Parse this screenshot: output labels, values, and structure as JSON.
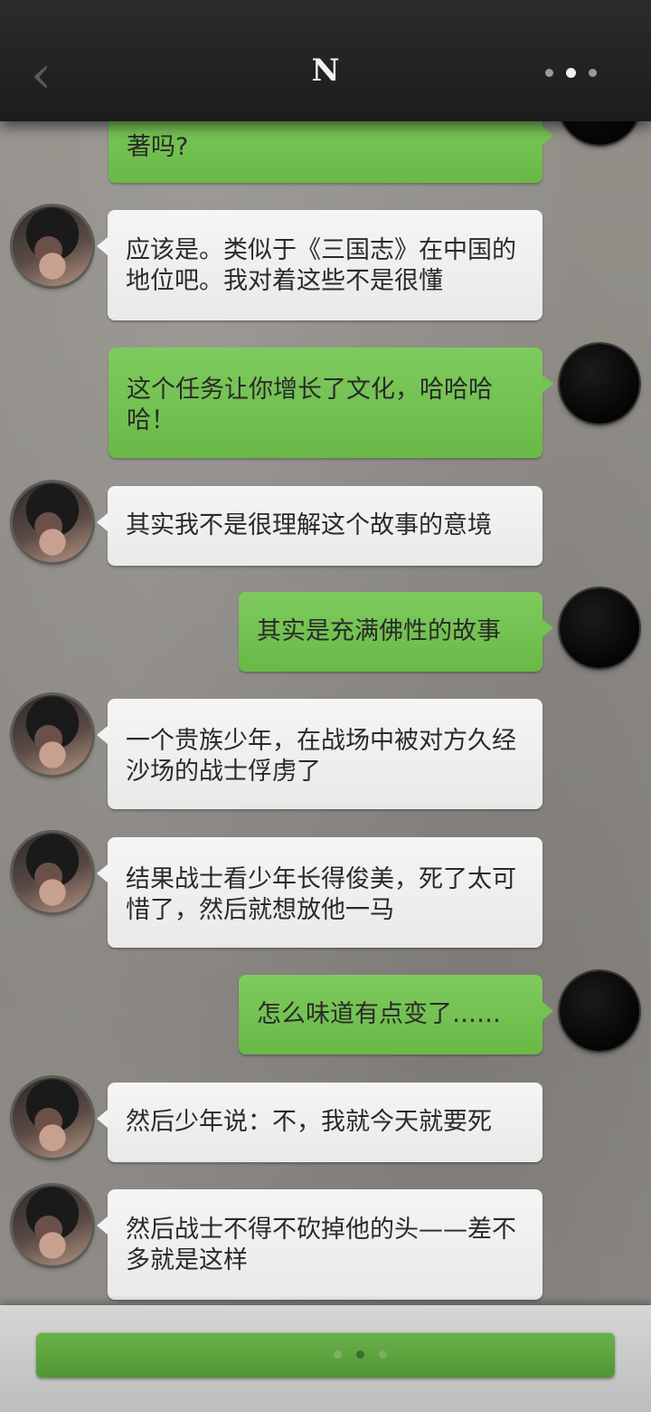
{
  "header": {
    "title": "N",
    "back_glyph": "‹"
  },
  "messages": [
    {
      "side": "right",
      "text": "著吗?"
    },
    {
      "side": "left",
      "text": "应该是。类似于《三国志》在中国的地位吧。我对着这些不是很懂"
    },
    {
      "side": "right",
      "text": "这个任务让你增长了文化，哈哈哈哈！"
    },
    {
      "side": "left",
      "text": "其实我不是很理解这个故事的意境"
    },
    {
      "side": "right",
      "text": "其实是充满佛性的故事"
    },
    {
      "side": "left",
      "text": "一个贵族少年，在战场中被对方久经沙场的战士俘虏了"
    },
    {
      "side": "left",
      "text": "结果战士看少年长得俊美，死了太可惜了，然后就想放他一马"
    },
    {
      "side": "right",
      "text": "怎么味道有点变了……"
    },
    {
      "side": "left",
      "text": "然后少年说：不，我就今天就要死"
    },
    {
      "side": "left",
      "text": "然后战士不得不砍掉他的头——差不多就是这样"
    }
  ],
  "colors": {
    "accent_green": "#6cb24a",
    "topbar": "#1c1c1c"
  },
  "icons": {
    "back": "chevron-left-icon",
    "more": "more-dots-icon",
    "typing": "typing-dots-icon"
  }
}
